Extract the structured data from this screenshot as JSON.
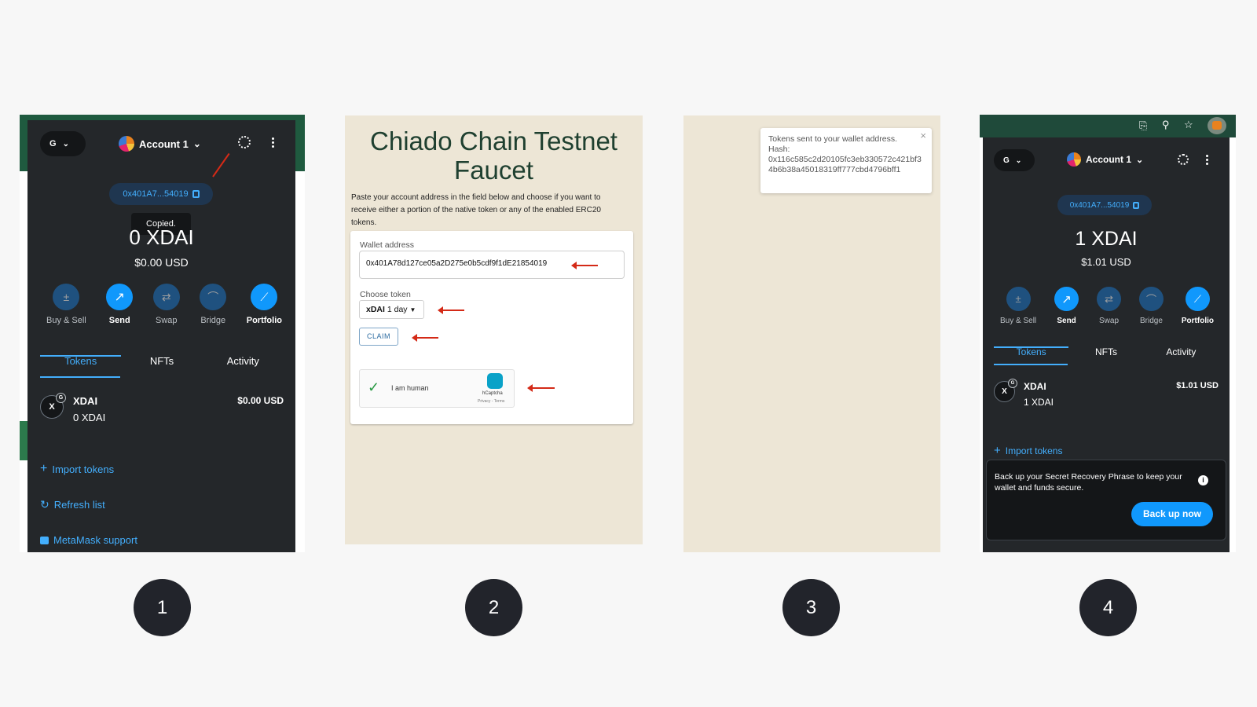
{
  "panel1": {
    "network_label": "G",
    "account_name": "Account 1",
    "address_short": "0x401A7...54019",
    "tooltip": "Copied.",
    "balance": "0 XDAI",
    "fiat": "$0.00 USD",
    "actions": [
      "Buy & Sell",
      "Send",
      "Swap",
      "Bridge",
      "Portfolio"
    ],
    "tabs": [
      "Tokens",
      "NFTs",
      "Activity"
    ],
    "token": {
      "symbol": "XDAI",
      "amount": "0 XDAI",
      "value": "$0.00 USD",
      "icon_letter": "X",
      "badge": "G"
    },
    "links": [
      "Import tokens",
      "Refresh list",
      "MetaMask support"
    ]
  },
  "panel2": {
    "title_line1": "Chiado Chain Testnet",
    "title_line2": "Faucet",
    "description": "Paste your account address in the field below and choose if you want to receive either a portion of the native token or any of the enabled ERC20 tokens.",
    "wallet_label": "Wallet address",
    "wallet_value": "0x401A78d127ce05a2D275e0b5cdf9f1dE21854019",
    "token_label": "Choose token",
    "token_bold": "xDAI",
    "token_period": "1 day",
    "claim_label": "CLAIM",
    "captcha_text": "I am human",
    "captcha_brand": "hCaptcha",
    "captcha_links": "Privacy - Terms"
  },
  "panel3": {
    "toast_line1": "Tokens sent to your wallet address.",
    "toast_line2": "Hash:",
    "toast_hash": "0x116c585c2d20105fc3eb330572c421bf34b6b38a45018319ff777cbd4796bff1",
    "close": "×"
  },
  "panel4": {
    "network_label": "G",
    "account_name": "Account 1",
    "address_short": "0x401A7...54019",
    "balance": "1 XDAI",
    "fiat": "$1.01 USD",
    "actions": [
      "Buy & Sell",
      "Send",
      "Swap",
      "Bridge",
      "Portfolio"
    ],
    "tabs": [
      "Tokens",
      "NFTs",
      "Activity"
    ],
    "token": {
      "symbol": "XDAI",
      "amount": "1 XDAI",
      "value": "$1.01 USD",
      "icon_letter": "X",
      "badge": "G"
    },
    "import_link": "Import tokens",
    "backup_text": "Back up your Secret Recovery Phrase to keep your wallet and funds secure.",
    "backup_button": "Back up now"
  },
  "steps": [
    "1",
    "2",
    "3",
    "4"
  ],
  "colors": {
    "metamask_bg": "#24272a",
    "accent_blue": "#43aefc",
    "faucet_bg": "#ede6d6",
    "arrow_red": "#d42a17",
    "browser_green": "#1f4a3a"
  }
}
